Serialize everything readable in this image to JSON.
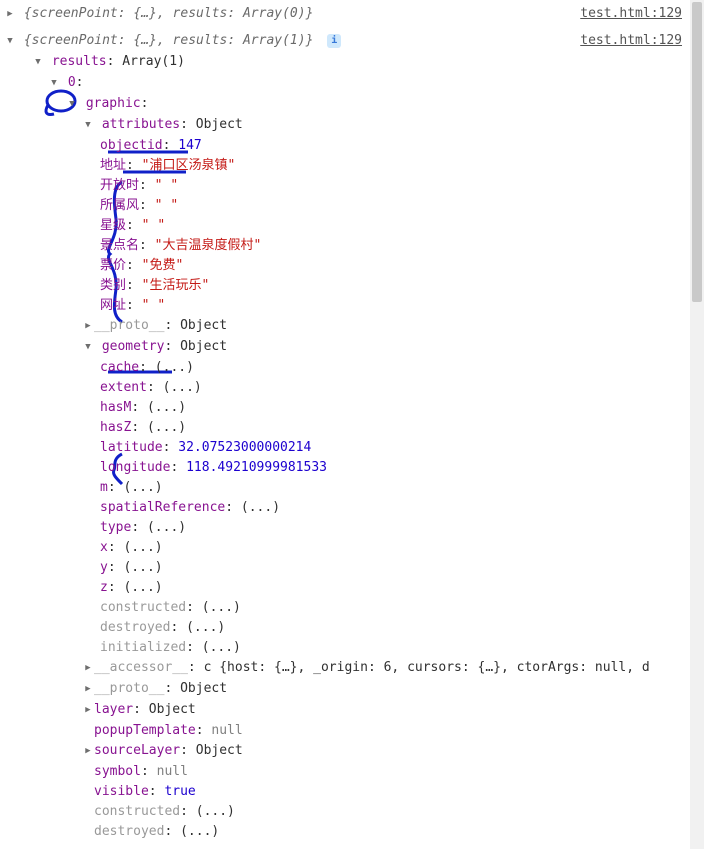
{
  "source_link": "test.html:129",
  "log1_summary": "{screenPoint: {…}, results: Array(0)}",
  "log2_summary": "{screenPoint: {…}, results: Array(1)}",
  "results_label": "results",
  "results_type": "Array(1)",
  "index0_label": "0",
  "graphic_label": "graphic",
  "attributes_label": "attributes",
  "object_text": "Object",
  "attrs": {
    "objectid_k": "objectid",
    "objectid_v": "147",
    "address_k": "地址",
    "address_v": "\"浦口区汤泉镇\"",
    "opentime_k": "开放时",
    "opentime_v": "\" \"",
    "belong_k": "所属风",
    "belong_v": "\" \"",
    "star_k": "星级",
    "star_v": "\" \"",
    "spot_k": "景点名",
    "spot_v": "\"大吉温泉度假村\"",
    "price_k": "票价",
    "price_v": "\"免费\"",
    "category_k": "类别",
    "category_v": "\"生活玩乐\"",
    "url_k": "网址",
    "url_v": "\" \""
  },
  "proto_label": "__proto__",
  "geometry_label": "geometry",
  "geom": {
    "cache_k": "cache",
    "extent_k": "extent",
    "hasM_k": "hasM",
    "hasZ_k": "hasZ",
    "lat_k": "latitude",
    "lat_v": "32.07523000000214",
    "lon_k": "longitude",
    "lon_v": "118.49210999981533",
    "m_k": "m",
    "sr_k": "spatialReference",
    "type_k": "type",
    "x_k": "x",
    "y_k": "y",
    "z_k": "z",
    "constructed_k": "constructed",
    "destroyed_k": "destroyed",
    "initialized_k": "initialized",
    "accessor_k": "__accessor__",
    "accessor_v": "c {host: {…}, _origin: 6, cursors: {…}, ctorArgs: null, d"
  },
  "ellipsis": "(...)",
  "layer_label": "layer",
  "popupTemplate_label": "popupTemplate",
  "null_text": "null",
  "sourceLayer_label": "sourceLayer",
  "symbol_label": "symbol",
  "visible_label": "visible",
  "true_text": "true",
  "constructed_label": "constructed",
  "destroyed_label": "destroyed"
}
